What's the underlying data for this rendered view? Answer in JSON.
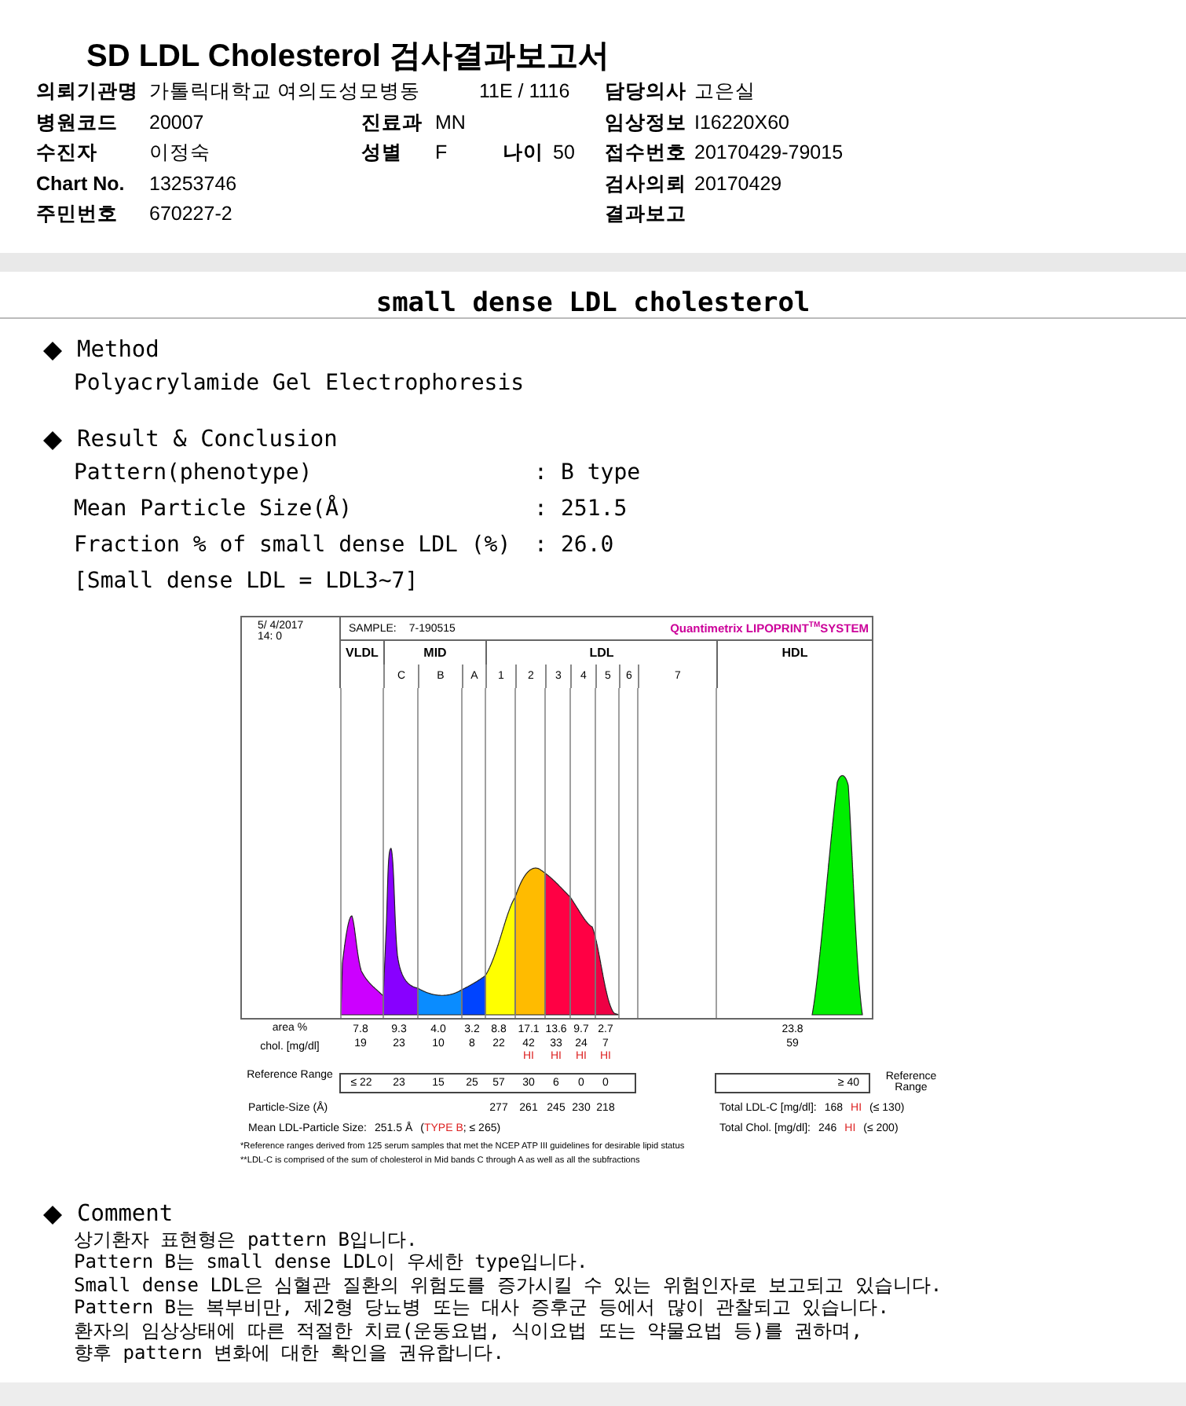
{
  "title": "SD LDL Cholesterol 검사결과보고서",
  "info": [
    {
      "left": {
        "label": "의뢰기관명",
        "value": "가톨릭대학교 여의도성모병동"
      },
      "middle": {
        "value": "11E / 1116"
      },
      "right": {
        "label": "담당의사",
        "value": "고은실"
      }
    },
    {
      "left": {
        "label": "병원코드",
        "value": "20007"
      },
      "middle": {
        "label": "진료과",
        "value": "MN"
      },
      "right": {
        "label": "임상정보",
        "value": "I16220X60"
      }
    },
    {
      "left": {
        "label": "수진자",
        "value": "이정숙"
      },
      "middle": {
        "label": "성별",
        "value": "F"
      },
      "age": {
        "label": "나이",
        "value": "50"
      },
      "right": {
        "label": "접수번호",
        "value": "20170429-79015"
      }
    },
    {
      "left": {
        "label": "Chart No.",
        "value": "13253746"
      },
      "right": {
        "label": "검사의뢰",
        "value": "20170429"
      }
    },
    {
      "left": {
        "label": "주민번호",
        "value": "670227-2"
      },
      "right": {
        "label": "결과보고"
      }
    }
  ],
  "report_title": "small dense LDL cholesterol",
  "method": {
    "heading": "Method",
    "text": "Polyacrylamide Gel Electrophoresis"
  },
  "result": {
    "heading": "Result & Conclusion",
    "items": [
      {
        "label": "Pattern(phenotype)",
        "separator": ":",
        "value": "B type"
      },
      {
        "label": "Mean Particle Size(Å)",
        "separator": ":",
        "value": "251.5"
      },
      {
        "label": "Fraction % of small dense LDL (%)",
        "separator": ":",
        "value": "26.0"
      }
    ],
    "note": "[Small dense LDL = LDL3~7]"
  },
  "chart": {
    "date": [
      "5/ 4/2017",
      "14: 0"
    ],
    "sample_label": "SAMPLE:",
    "sample": "7-190515",
    "brand": "Quantimetrix LIPOPRINT$^{TM}$SYSTEM",
    "groups": [
      {
        "label": "VLDL"
      },
      {
        "label": "MID"
      },
      {
        "label": "LDL"
      },
      {
        "label": "HDL"
      }
    ],
    "bands": [
      {
        "color": "#cc00ff",
        "area": "7.8",
        "chol": "19",
        "reference": "≤ 22"
      },
      {
        "label": "C",
        "color": "#8800ff",
        "area": "9.3",
        "chol": "23",
        "reference": "23"
      },
      {
        "label": "B",
        "color": "#0a8cff",
        "area": "4.0",
        "chol": "10",
        "reference": "15"
      },
      {
        "label": "A",
        "color": "#0044ff",
        "area": "3.2",
        "chol": "8",
        "reference": "25"
      },
      {
        "label": "1",
        "color": "#ffff00",
        "area": "8.8",
        "chol": "22",
        "reference": "57",
        "particle_size": "277"
      },
      {
        "label": "2",
        "color": "#ffbb00",
        "area": "17.1",
        "chol": "42",
        "chol_flag": "HI",
        "reference": "30",
        "particle_size": "261"
      },
      {
        "label": "3",
        "color": "#ff0044",
        "area": "13.6",
        "chol": "33",
        "chol_flag": "HI",
        "reference": "6",
        "particle_size": "245"
      },
      {
        "label": "4",
        "color": "#ff0044",
        "area": "9.7",
        "chol": "24",
        "chol_flag": "HI",
        "reference": "0",
        "particle_size": "230"
      },
      {
        "label": "5",
        "color": "#ee0044",
        "area": "2.7",
        "chol": "7",
        "chol_flag": "HI",
        "reference": "0",
        "particle_size": "218"
      },
      {
        "label": "6"
      },
      {
        "label": "7"
      },
      {
        "color": "#00ee00",
        "area": "23.8",
        "chol": "59",
        "reference": "≥ 40"
      }
    ],
    "row_labels": {
      "area": "area %",
      "chol": "chol. [mg/dl]",
      "reference": "Reference Range",
      "particle_size": "Particle-Size (Å)"
    },
    "side_label": "Reference Range",
    "total_ldl": {
      "label": "Total LDL-C [mg/dl]:",
      "value": "168",
      "flag": "HI",
      "limit": "(≤ 130)"
    },
    "total_chol": {
      "label": "Total Chol. [mg/dl]:",
      "value": "246",
      "flag": "HI",
      "limit": "(≤ 200)"
    },
    "mean": {
      "label": "Mean LDL-Particle Size:",
      "value": "251.5 Å",
      "open": "(",
      "type": "TYPE B",
      "rest": "; ≤ 265)"
    },
    "footnotes": [
      "*Reference ranges derived from 125 serum samples that met the NCEP ATP III guidelines for desirable lipid status",
      "**LDL-C is comprised of the sum of cholesterol in Mid bands C through A as well as all the subfractions"
    ]
  },
  "comment": {
    "heading": "Comment",
    "lines": [
      "상기환자 표현형은 pattern B입니다.",
      "Pattern B는 small dense LDL이 우세한 type입니다.",
      "Small dense LDL은 심혈관 질환의 위험도를 증가시킬 수 있는 위험인자로 보고되고 있습니다.",
      "Pattern B는 복부비만, 제2형 당뇨병 또는 대사 증후군 등에서 많이 관찰되고 있습니다.",
      "환자의 임상상태에 따른 적절한 치료(운동요법, 식이요법 또는 약물요법 등)를 권하며,",
      "향후 pattern 변화에 대한 확인을 권유합니다."
    ]
  }
}
